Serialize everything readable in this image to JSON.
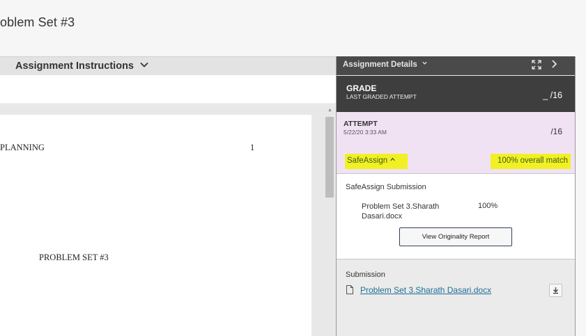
{
  "page": {
    "title": "oblem Set #3"
  },
  "left": {
    "header_label": "Assignment Instructions",
    "doc": {
      "running_head": "PLANNING",
      "page_number": "1",
      "center_title": "PROBLEM SET #3"
    }
  },
  "details": {
    "header_title": "Assignment Details",
    "grade": {
      "label": "GRADE",
      "sublabel": "LAST GRADED ATTEMPT",
      "score": "_ /16"
    },
    "attempt": {
      "label": "ATTEMPT",
      "date": "5/22/20 3:33 AM",
      "score": "/16"
    },
    "safeassign": {
      "toggle_label": "SafeAssign",
      "overall_match": "100% overall match",
      "section_title": "SafeAssign Submission",
      "file_name": "Problem Set 3.Sharath Dasari.docx",
      "file_percent": "100%",
      "report_button": "View Originality Report"
    },
    "submission": {
      "title": "Submission",
      "file_link": "Problem Set 3.Sharath Dasari.docx"
    }
  },
  "colors": {
    "highlight": "#f1f024",
    "attempt_bg": "#f1e2f3",
    "dark_header": "#3e3e3e",
    "link": "#1f6d97"
  }
}
